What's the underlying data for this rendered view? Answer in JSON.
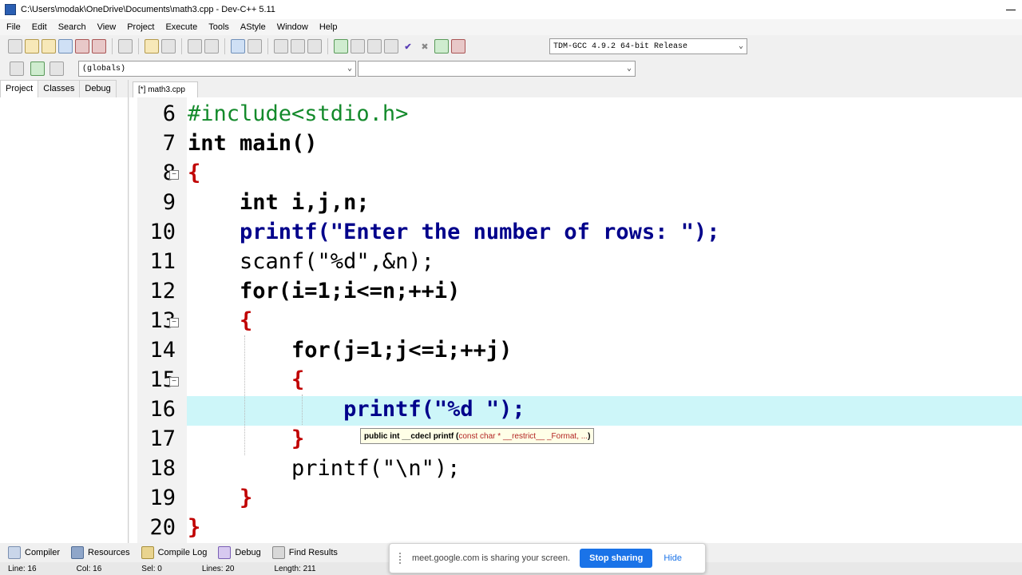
{
  "window": {
    "title": "C:\\Users\\modak\\OneDrive\\Documents\\math3.cpp - Dev-C++ 5.11"
  },
  "menu": [
    "File",
    "Edit",
    "Search",
    "View",
    "Project",
    "Execute",
    "Tools",
    "AStyle",
    "Window",
    "Help"
  ],
  "toolbar": {
    "compiler_select": "TDM-GCC 4.9.2 64-bit Release",
    "scope_select": "(globals)",
    "member_select": ""
  },
  "left_panel": {
    "tabs": [
      "Project",
      "Classes",
      "Debug"
    ]
  },
  "editor": {
    "file_tab": "[*] math3.cpp",
    "lines": [
      {
        "n": "6"
      },
      {
        "n": "7"
      },
      {
        "n": "8"
      },
      {
        "n": "9"
      },
      {
        "n": "10"
      },
      {
        "n": "11"
      },
      {
        "n": "12"
      },
      {
        "n": "13"
      },
      {
        "n": "14"
      },
      {
        "n": "15"
      },
      {
        "n": "16"
      },
      {
        "n": "17"
      },
      {
        "n": "18"
      },
      {
        "n": "19"
      },
      {
        "n": "20"
      }
    ],
    "code_text": [
      "#include<stdio.h>",
      "int main()",
      "{",
      "    int i,j,n;",
      "    printf(\"Enter the number of rows: \");",
      "    scanf(\"%d\",&n);",
      "    for(i=1;i<=n;++i)",
      "    {",
      "        for(j=1;j<=i;++j)",
      "        {",
      "            printf(\"%d \");",
      "        }",
      "        printf(\"\\n\");",
      "    }",
      "}"
    ],
    "tooltip": {
      "prefix": "public int __cdecl printf (",
      "params": "const char * __restrict__ _Format, ...",
      "suffix": ")"
    }
  },
  "bottom_tabs": [
    "Compiler",
    "Resources",
    "Compile Log",
    "Debug",
    "Find Results"
  ],
  "status": {
    "line": "Line: 16",
    "col": "Col: 16",
    "sel": "Sel: 0",
    "lines": "Lines: 20",
    "length": "Length: 211"
  },
  "share_banner": {
    "message": "meet.google.com is sharing your screen.",
    "stop_label": "Stop sharing",
    "hide_label": "Hide"
  }
}
